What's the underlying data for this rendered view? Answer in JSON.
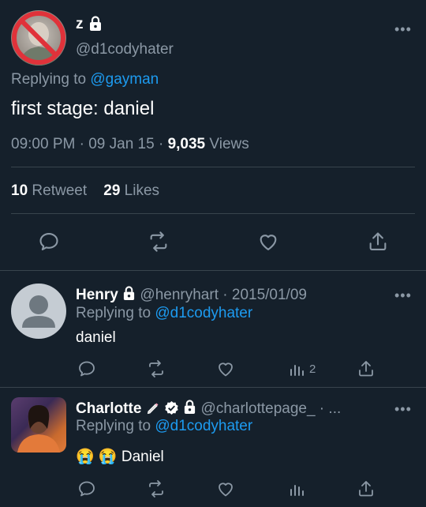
{
  "main_tweet": {
    "display_name": "z",
    "handle": "@d1codyhater",
    "replying_prefix": "Replying to",
    "replying_handle": "@gayman",
    "text": "first stage: daniel",
    "time": "09:00 PM",
    "date": "09 Jan 15",
    "views_count": "9,035",
    "views_label": "Views",
    "retweet_count": "10",
    "retweet_label": "Retweet",
    "likes_count": "29",
    "likes_label": "Likes",
    "more_label": "•••"
  },
  "replies": [
    {
      "display_name": "Henry",
      "handle": "@henryhart",
      "date": "· 2015/01/09",
      "replying_prefix": "Replying to",
      "replying_handle": "@d1codyhater",
      "text": "daniel",
      "views_count": "2",
      "more_label": "•••"
    },
    {
      "display_name": "Charlotte",
      "handle": "@charlottepage_ · ...",
      "replying_prefix": "Replying to",
      "replying_handle": "@d1codyhater",
      "emoji": "😭 😭",
      "text": "Daniel",
      "more_label": "•••"
    }
  ],
  "colors": {
    "background": "#15202b",
    "muted": "#8b98a5",
    "link": "#1d9bf0",
    "divider": "#38444d"
  }
}
